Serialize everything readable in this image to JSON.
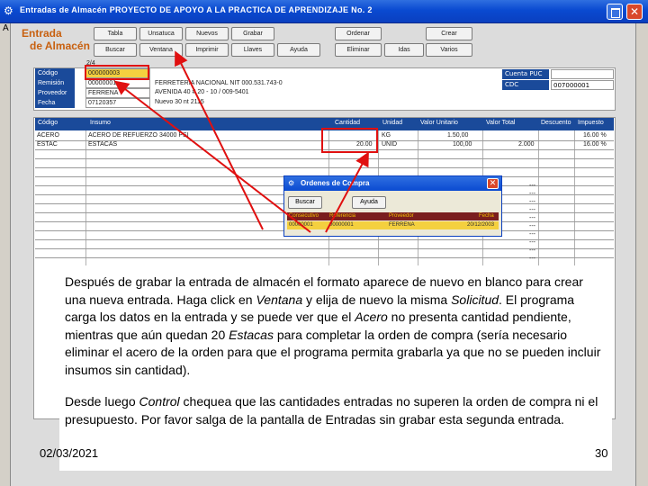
{
  "window": {
    "title": "Entradas de Almacén   PROYECTO DE APOYO A LA PRACTICA DE APRENDIZAJE No. 2",
    "close_glyph": "✕",
    "background_letter": "A"
  },
  "brand": {
    "line1": "Entrada",
    "line2": "de Almacén",
    "color": "#c8600f"
  },
  "toolbar": {
    "row1": [
      "Tabla",
      "Unsatuca",
      "Nuevos",
      "Grabar",
      "Ordenar",
      "Crear"
    ],
    "row2": [
      "Buscar",
      "Ventana",
      "Imprimir",
      "Llaves",
      "Ayuda",
      "Eliminar",
      "Idas",
      "Varios"
    ]
  },
  "header": {
    "labels": [
      "Código",
      "Remisión",
      "Proveedor",
      "Fecha"
    ],
    "values": [
      "000000003",
      "00000001",
      "FERRENA",
      "07120357"
    ],
    "top_note": "2/4",
    "info": [
      "FERRETERIA NACIONAL    NIT 000.531.743-0",
      "AVENIDA 40 # 20 - 10 / 009-5401",
      "Nuevo 30 nt 2115"
    ],
    "puc_label": "Cuenta PUC",
    "cdc_label": "CDC",
    "cdc_value": "007000001"
  },
  "table": {
    "columns": [
      "Código",
      "Insumo",
      "Cantidad",
      "Unidad",
      "Valor Unitario",
      "Valor Total",
      "Descuento",
      "Impuesto"
    ],
    "rows": [
      [
        "ACERO",
        "ACERO DE REFUERZO 34000 PSI",
        "",
        "KG",
        "1.50,00",
        "",
        "",
        "16.00 %"
      ],
      [
        "ESTAC",
        "ESTACAS",
        "20.00",
        "UNID",
        "100,00",
        "2.000",
        "",
        "16.00 %"
      ]
    ]
  },
  "dialog": {
    "title": "Ordenes de Compra",
    "buttons": [
      "Buscar",
      "Ayuda"
    ],
    "columns": [
      "Consecutivo",
      "Referencia",
      "Proveedor",
      "Fecha"
    ],
    "row": [
      "00000001",
      "00000001",
      "FERRENA",
      "20/12/2003"
    ],
    "close_glyph": "✕"
  },
  "note": {
    "paragraph1_parts": [
      {
        "t": "Después de grabar la entrada de almacén el formato aparece de nuevo en blanco para crear una nueva entrada. Haga click en ",
        "i": false
      },
      {
        "t": "Ventana",
        "i": true
      },
      {
        "t": " y elija de nuevo la misma ",
        "i": false
      },
      {
        "t": "Solicitud",
        "i": true
      },
      {
        "t": ". El programa carga los datos en la entrada y se puede ver que el ",
        "i": false
      },
      {
        "t": "Acero",
        "i": true
      },
      {
        "t": " no presenta cantidad pendiente, mientras que aún quedan 20 ",
        "i": false
      },
      {
        "t": "Estacas",
        "i": true
      },
      {
        "t": " para completar la orden de compra (sería necesario eliminar el acero de la orden para que el programa permita grabarla ya que no se pueden incluir insumos sin cantidad).",
        "i": false
      }
    ],
    "paragraph2_parts": [
      {
        "t": "Desde luego ",
        "i": false
      },
      {
        "t": "Control",
        "i": true
      },
      {
        "t": " chequea que las cantidades entradas no superen la orden de compra ni el presupuesto. Por favor salga de la pantalla de Entradas sin grabar esta segunda entrada.",
        "i": false
      }
    ]
  },
  "footer": {
    "date": "02/03/2021",
    "page": "30"
  },
  "colors": {
    "highlight_red": "#e01010",
    "header_blue": "#1a4a9a",
    "field_yellow": "#f4d03f"
  }
}
